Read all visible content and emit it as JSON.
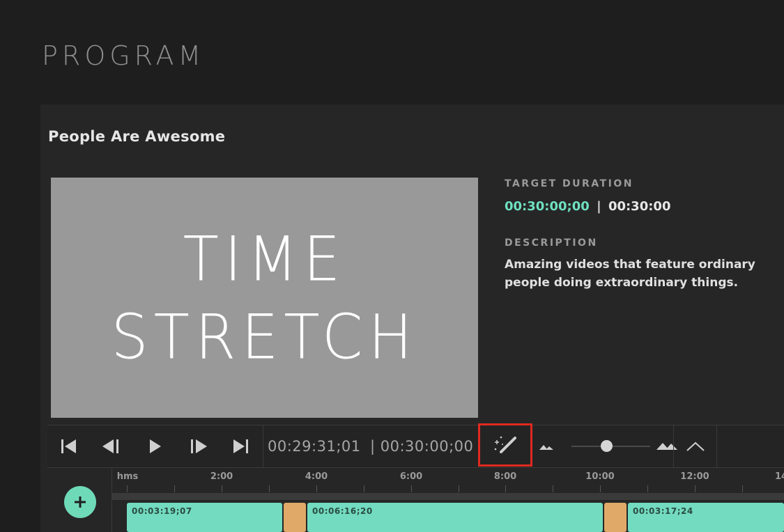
{
  "page": {
    "title": "PROGRAM"
  },
  "program": {
    "name": "People Are Awesome"
  },
  "preview": {
    "line1": "TIME",
    "line2": "STRETCH"
  },
  "meta": {
    "target_duration_label": "TARGET DURATION",
    "current_duration": "00:30:00;00",
    "separator": "|",
    "target_duration": "00:30:00",
    "description_label": "DESCRIPTION",
    "description_line1": "Amazing videos that feature ordinary",
    "description_line2": "people doing extraordinary things."
  },
  "transport": {
    "current_timecode": "00:29:31;01",
    "total_timecode": "| 00:30:00;00",
    "icons": [
      "skip-to-start-icon",
      "step-back-icon",
      "play-icon",
      "step-forward-icon",
      "skip-to-end-icon",
      "magic-wand-icon",
      "zoom-out-icon",
      "zoom-in-icon",
      "chevron-up-icon"
    ],
    "zoom_level": 0.45
  },
  "timeline": {
    "ruler_labels": [
      "hms",
      "2:00",
      "4:00",
      "6:00",
      "8:00",
      "10:00",
      "12:00",
      "14"
    ],
    "clips": [
      {
        "type": "segment",
        "label": "00:03:19;07"
      },
      {
        "type": "break",
        "label": ""
      },
      {
        "type": "segment",
        "label": "00:06:16;20"
      },
      {
        "type": "break",
        "label": ""
      },
      {
        "type": "segment",
        "label": "00:03:17;24"
      }
    ],
    "add_icon": "plus-icon"
  },
  "colors": {
    "accent": "#6fe0c0",
    "segment": "#72dbc0",
    "break": "#e0a968",
    "highlight": "#e0291f"
  }
}
